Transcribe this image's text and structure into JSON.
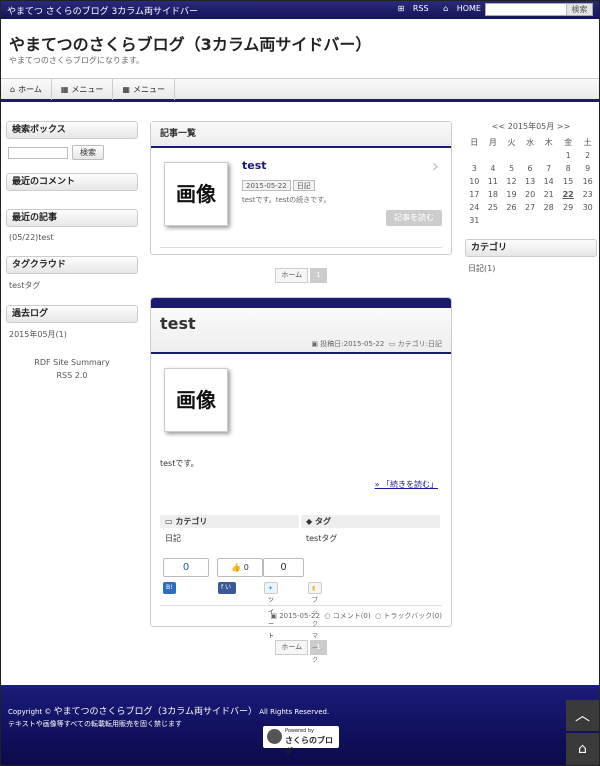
{
  "topbar": {
    "site": "やまてつ さくらのブログ 3カラム両サイドバー",
    "rss": "RSS",
    "home": "HOME",
    "search_button": "検索",
    "icon_rss": "rss-icon",
    "icon_home": "home-icon"
  },
  "header": {
    "title": "やまてつのさくらブログ（3カラム両サイドバー）",
    "description": "やまてつのさくらブログになります。"
  },
  "nav": {
    "items": [
      {
        "label": "ホーム",
        "icon": "home-icon"
      },
      {
        "label": "メニュー",
        "icon": "grid-icon"
      },
      {
        "label": "メニュー",
        "icon": "grid-icon"
      }
    ]
  },
  "left_sidebar": {
    "search_title": "検索ボックス",
    "search_button": "検索",
    "recent_comments_title": "最近のコメント",
    "recent_posts_title": "最近の記事",
    "recent_post": "(05/22)test",
    "tag_cloud_title": "タグクラウド",
    "tag": "testタグ",
    "archive_title": "過去ログ",
    "archive_item": "2015年05月(1)",
    "rdf": "RDF Site Summary",
    "rss2": "RSS 2.0"
  },
  "article_list": {
    "title": "記事一覧",
    "entry": {
      "thumb": "画像",
      "title": "test",
      "date": "2015-05-22",
      "category": "日記",
      "excerpt": "testです。testの続きです。",
      "read_more": "記事を読む"
    }
  },
  "pager": {
    "home": "ホーム",
    "current": "1"
  },
  "post": {
    "title": "test",
    "meta_date": "投稿日:2015-05-22",
    "meta_category": "カテゴリ:日記",
    "thumb": "画像",
    "body": "testです。",
    "continue": "» 「続きを読む」",
    "category_header": "カテゴリ",
    "category_value": "日記",
    "tag_header": "タグ",
    "tag_value": "testタグ",
    "count_bookmark": "0",
    "count_like": "0",
    "count_tweet": "0",
    "btn_bookmark": "ブックマーク",
    "btn_like": "いいね！",
    "btn_tweet": "ツイート",
    "btn_bookmark2": "ブックマーク",
    "foot_date": "2015-05-22",
    "foot_comment": "コメント(0)",
    "foot_trackback": "トラックバック(0)"
  },
  "pager2": {
    "home": "ホーム",
    "current": "1"
  },
  "calendar": {
    "title": "<< 2015年05月 >>",
    "weekdays": [
      "日",
      "月",
      "火",
      "水",
      "木",
      "金",
      "土"
    ],
    "weeks": [
      [
        "",
        "",
        "",
        "",
        "",
        "1",
        "2"
      ],
      [
        "3",
        "4",
        "5",
        "6",
        "7",
        "8",
        "9"
      ],
      [
        "10",
        "11",
        "12",
        "13",
        "14",
        "15",
        "16"
      ],
      [
        "17",
        "18",
        "19",
        "20",
        "21",
        "22",
        "23"
      ],
      [
        "24",
        "25",
        "26",
        "27",
        "28",
        "29",
        "30"
      ],
      [
        "31",
        "",
        "",
        "",
        "",
        "",
        ""
      ]
    ],
    "today": "22"
  },
  "right_sidebar": {
    "category_title": "カテゴリ",
    "category_item": "日記(1)"
  },
  "footer": {
    "copyright_prefix": "Copyright ©",
    "site": "やまてつのさくらブログ（3カラム両サイドバー）",
    "rights": "All Rights Reserved.",
    "note": "テキストや画像等すべての転載転用販売を固く禁じます",
    "logo_powered": "Powered by",
    "logo_name": "さくらのブログ"
  },
  "colors": {
    "accent": "#1a1a72",
    "link": "#1a1a9a"
  }
}
